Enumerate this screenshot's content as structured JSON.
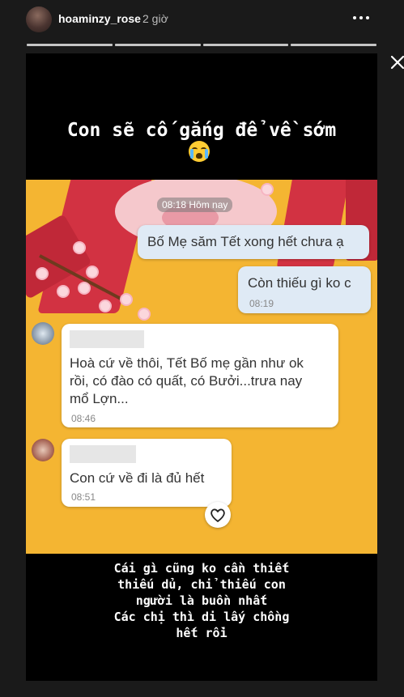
{
  "header": {
    "username": "hoaminzy_rose",
    "time": "2 giờ",
    "more_icon": "more-horizontal-icon",
    "close_icon": "close-icon"
  },
  "progress": {
    "segments": 4,
    "current_segment": 4
  },
  "story": {
    "caption_top": "Con sẽ cố gắng để về sớm",
    "caption_top_emoji": "loudly-crying-face",
    "screenshot": {
      "date_label": "08:18 Hôm nay",
      "messages": [
        {
          "direction": "out",
          "text": "Bố Mẹ săm Tết xong hết chưa ạ",
          "time": ""
        },
        {
          "direction": "out",
          "text": "Còn thiếu gì ko c",
          "time": "08:19"
        },
        {
          "direction": "in",
          "lines": [
            "Hoà cứ về thôi, Tết Bố mẹ gần như ok",
            "rồi, có đào có quất, có Bưởi...trưa nay",
            "mổ Lợn..."
          ],
          "time": "08:46"
        },
        {
          "direction": "in",
          "text": "Con cứ về đi là đủ hết",
          "time": "08:51"
        }
      ],
      "heart_icon": "heart-outline-icon"
    },
    "caption_bottom_lines": [
      "Cái gì cũng ko cần thiết",
      "thiếu dủ, chỉ thiếu con",
      "người là buồn nhất",
      "Các chị thì di lấy chồng",
      "hết rồi"
    ]
  },
  "colors": {
    "background": "#1a1a1a",
    "story_bg": "#000000",
    "screenshot_bg": "#f4b532",
    "bubble_out": "#dfeaf5"
  }
}
